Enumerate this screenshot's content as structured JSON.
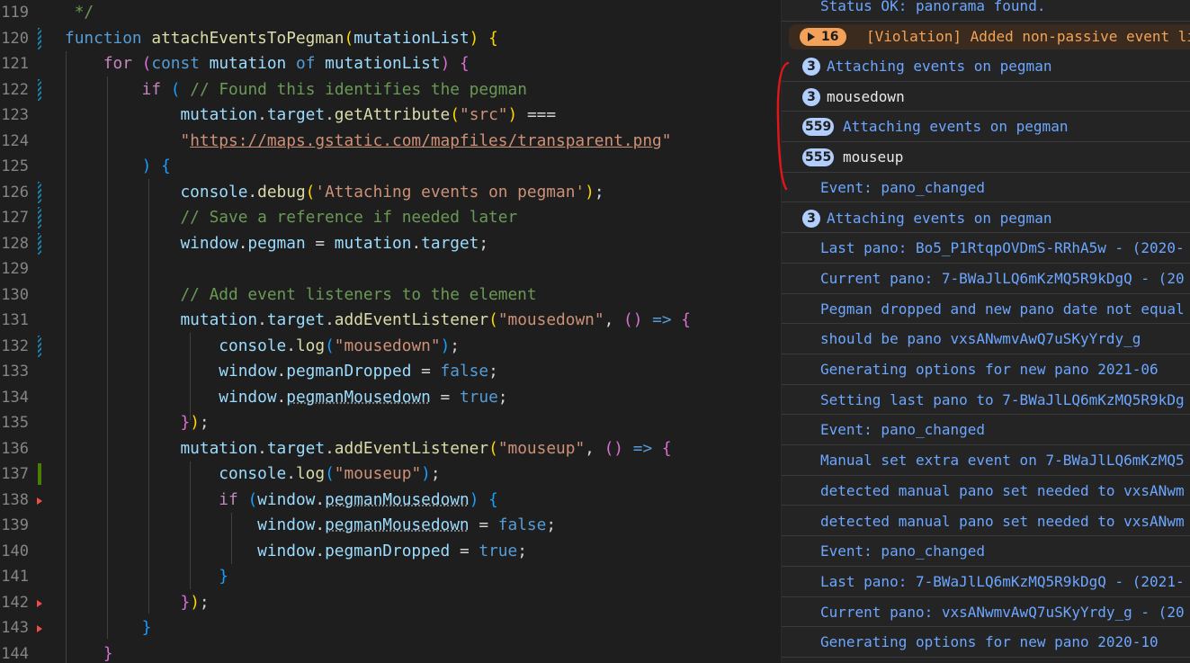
{
  "editor": {
    "lines": [
      {
        "n": "119",
        "gutter": "",
        "tokens": [
          [
            "t-cmt",
            " */"
          ]
        ]
      },
      {
        "n": "120",
        "gutter": "mod",
        "tokens": [
          [
            "t-kw",
            "function "
          ],
          [
            "t-fn",
            "attachEventsToPegman"
          ],
          [
            "t-p1",
            "("
          ],
          [
            "t-var",
            "mutationList"
          ],
          [
            "t-p1",
            ")"
          ],
          [
            "t-op",
            " "
          ],
          [
            "t-p1",
            "{"
          ]
        ]
      },
      {
        "n": "121",
        "gutter": "",
        "tokens": [
          [
            "t-op",
            "    "
          ],
          [
            "t-ctl",
            "for"
          ],
          [
            "t-op",
            " "
          ],
          [
            "t-p2",
            "("
          ],
          [
            "t-kw",
            "const "
          ],
          [
            "t-var",
            "mutation"
          ],
          [
            "t-op",
            " "
          ],
          [
            "t-kw",
            "of "
          ],
          [
            "t-var",
            "mutationList"
          ],
          [
            "t-p2",
            ")"
          ],
          [
            "t-op",
            " "
          ],
          [
            "t-p2",
            "{"
          ]
        ]
      },
      {
        "n": "122",
        "gutter": "mod",
        "tokens": [
          [
            "t-op",
            "        "
          ],
          [
            "t-ctl",
            "if"
          ],
          [
            "t-op",
            " "
          ],
          [
            "t-p3",
            "("
          ],
          [
            "t-op",
            " "
          ],
          [
            "t-cmt",
            "// Found this identifies the pegman"
          ]
        ]
      },
      {
        "n": "123",
        "gutter": "",
        "tokens": [
          [
            "t-op",
            "            "
          ],
          [
            "t-var",
            "mutation"
          ],
          [
            "t-op",
            "."
          ],
          [
            "t-var",
            "target"
          ],
          [
            "t-op",
            "."
          ],
          [
            "t-fn",
            "getAttribute"
          ],
          [
            "t-p1",
            "("
          ],
          [
            "t-str",
            "\"src\""
          ],
          [
            "t-p1",
            ")"
          ],
          [
            "t-op",
            " ==="
          ]
        ]
      },
      {
        "n": "124",
        "gutter": "",
        "tokens": [
          [
            "t-op",
            "            "
          ],
          [
            "t-str",
            "\""
          ],
          [
            "t-link",
            "https://maps.gstatic.com/mapfiles/transparent.png"
          ],
          [
            "t-str",
            "\""
          ]
        ]
      },
      {
        "n": "125",
        "gutter": "",
        "tokens": [
          [
            "t-op",
            "        "
          ],
          [
            "t-p3",
            ")"
          ],
          [
            "t-op",
            " "
          ],
          [
            "t-p3",
            "{"
          ]
        ]
      },
      {
        "n": "126",
        "gutter": "mod",
        "tokens": [
          [
            "t-op",
            "            "
          ],
          [
            "t-var",
            "console"
          ],
          [
            "t-op",
            "."
          ],
          [
            "t-fn",
            "debug"
          ],
          [
            "t-p1",
            "("
          ],
          [
            "t-str",
            "'Attaching events on pegman'"
          ],
          [
            "t-p1",
            ")"
          ],
          [
            "t-op",
            ";"
          ]
        ]
      },
      {
        "n": "127",
        "gutter": "mod",
        "tokens": [
          [
            "t-op",
            "            "
          ],
          [
            "t-cmt",
            "// Save a reference if needed later"
          ]
        ]
      },
      {
        "n": "128",
        "gutter": "mod",
        "tokens": [
          [
            "t-op",
            "            "
          ],
          [
            "t-var",
            "window"
          ],
          [
            "t-op",
            "."
          ],
          [
            "t-var",
            "pegman"
          ],
          [
            "t-op",
            " = "
          ],
          [
            "t-var",
            "mutation"
          ],
          [
            "t-op",
            "."
          ],
          [
            "t-var",
            "target"
          ],
          [
            "t-op",
            ";"
          ]
        ]
      },
      {
        "n": "129",
        "gutter": "",
        "tokens": []
      },
      {
        "n": "130",
        "gutter": "",
        "tokens": [
          [
            "t-op",
            "            "
          ],
          [
            "t-cmt",
            "// Add event listeners to the element"
          ]
        ]
      },
      {
        "n": "131",
        "gutter": "",
        "tokens": [
          [
            "t-op",
            "            "
          ],
          [
            "t-var",
            "mutation"
          ],
          [
            "t-op",
            "."
          ],
          [
            "t-var",
            "target"
          ],
          [
            "t-op",
            "."
          ],
          [
            "t-fn",
            "addEventListener"
          ],
          [
            "t-p1",
            "("
          ],
          [
            "t-str",
            "\"mousedown\""
          ],
          [
            "t-op",
            ", "
          ],
          [
            "t-p2",
            "()"
          ],
          [
            "t-op",
            " "
          ],
          [
            "t-kw",
            "=>"
          ],
          [
            "t-op",
            " "
          ],
          [
            "t-p2",
            "{"
          ]
        ]
      },
      {
        "n": "132",
        "gutter": "mod",
        "tokens": [
          [
            "t-op",
            "                "
          ],
          [
            "t-var",
            "console"
          ],
          [
            "t-op",
            "."
          ],
          [
            "t-fn",
            "log"
          ],
          [
            "t-p3",
            "("
          ],
          [
            "t-str",
            "\"mousedown\""
          ],
          [
            "t-p3",
            ")"
          ],
          [
            "t-op",
            ";"
          ]
        ]
      },
      {
        "n": "133",
        "gutter": "",
        "tokens": [
          [
            "t-op",
            "                "
          ],
          [
            "t-var",
            "window"
          ],
          [
            "t-op",
            "."
          ],
          [
            "t-var",
            "pegmanDropped"
          ],
          [
            "t-op",
            " = "
          ],
          [
            "t-kw",
            "false"
          ],
          [
            "t-op",
            ";"
          ]
        ]
      },
      {
        "n": "134",
        "gutter": "",
        "tokens": [
          [
            "t-op",
            "                "
          ],
          [
            "t-var",
            "window"
          ],
          [
            "t-op",
            "."
          ],
          [
            "t-var t-dot",
            "pegmanMousedown"
          ],
          [
            "t-op",
            " = "
          ],
          [
            "t-kw",
            "true"
          ],
          [
            "t-op",
            ";"
          ]
        ]
      },
      {
        "n": "135",
        "gutter": "",
        "tokens": [
          [
            "t-op",
            "            "
          ],
          [
            "t-p2",
            "}"
          ],
          [
            "t-p1",
            ")"
          ],
          [
            "t-op",
            ";"
          ]
        ]
      },
      {
        "n": "136",
        "gutter": "",
        "tokens": [
          [
            "t-op",
            "            "
          ],
          [
            "t-var",
            "mutation"
          ],
          [
            "t-op",
            "."
          ],
          [
            "t-var",
            "target"
          ],
          [
            "t-op",
            "."
          ],
          [
            "t-fn",
            "addEventListener"
          ],
          [
            "t-p1",
            "("
          ],
          [
            "t-str",
            "\"mouseup\""
          ],
          [
            "t-op",
            ", "
          ],
          [
            "t-p2",
            "()"
          ],
          [
            "t-op",
            " "
          ],
          [
            "t-kw",
            "=>"
          ],
          [
            "t-op",
            " "
          ],
          [
            "t-p2",
            "{"
          ]
        ]
      },
      {
        "n": "137",
        "gutter": "add",
        "tokens": [
          [
            "t-op",
            "                "
          ],
          [
            "t-var",
            "console"
          ],
          [
            "t-op",
            "."
          ],
          [
            "t-fn",
            "log"
          ],
          [
            "t-p3",
            "("
          ],
          [
            "t-str",
            "\"mouseup\""
          ],
          [
            "t-p3",
            ")"
          ],
          [
            "t-op",
            ";"
          ]
        ]
      },
      {
        "n": "138",
        "gutter": "del",
        "tokens": [
          [
            "t-op",
            "                "
          ],
          [
            "t-ctl",
            "if"
          ],
          [
            "t-op",
            " "
          ],
          [
            "t-p3",
            "("
          ],
          [
            "t-var",
            "window"
          ],
          [
            "t-op",
            "."
          ],
          [
            "t-var t-dot",
            "pegmanMousedown"
          ],
          [
            "t-p3",
            ")"
          ],
          [
            "t-op",
            " "
          ],
          [
            "t-p3",
            "{"
          ]
        ]
      },
      {
        "n": "139",
        "gutter": "",
        "tokens": [
          [
            "t-op",
            "                    "
          ],
          [
            "t-var",
            "window"
          ],
          [
            "t-op",
            "."
          ],
          [
            "t-var t-dot",
            "pegmanMousedown"
          ],
          [
            "t-op",
            " = "
          ],
          [
            "t-kw",
            "false"
          ],
          [
            "t-op",
            ";"
          ]
        ]
      },
      {
        "n": "140",
        "gutter": "",
        "tokens": [
          [
            "t-op",
            "                    "
          ],
          [
            "t-var",
            "window"
          ],
          [
            "t-op",
            "."
          ],
          [
            "t-var",
            "pegmanDropped"
          ],
          [
            "t-op",
            " = "
          ],
          [
            "t-kw",
            "true"
          ],
          [
            "t-op",
            ";"
          ]
        ]
      },
      {
        "n": "141",
        "gutter": "",
        "tokens": [
          [
            "t-op",
            "                "
          ],
          [
            "t-p3",
            "}"
          ]
        ]
      },
      {
        "n": "142",
        "gutter": "del",
        "tokens": [
          [
            "t-op",
            "            "
          ],
          [
            "t-p2",
            "}"
          ],
          [
            "t-p1",
            ")"
          ],
          [
            "t-op",
            ";"
          ]
        ]
      },
      {
        "n": "143",
        "gutter": "del",
        "tokens": [
          [
            "t-op",
            "        "
          ],
          [
            "t-p3",
            "}"
          ]
        ]
      },
      {
        "n": "144",
        "gutter": "",
        "tokens": [
          [
            "t-op",
            "    "
          ],
          [
            "t-p2",
            "}"
          ]
        ]
      }
    ]
  },
  "console": {
    "top_message": "Status OK: panorama found.",
    "warning": {
      "count": "16",
      "text": "[Violation] Added non-passive event li"
    },
    "messages": [
      {
        "badge": "3",
        "text": "Attaching events on pegman",
        "color": "blue"
      },
      {
        "badge": "3",
        "text": "mousedown",
        "color": "white"
      },
      {
        "badge": "559",
        "text": "Attaching events on pegman",
        "color": "blue"
      },
      {
        "badge": "555",
        "text": "mouseup",
        "color": "white"
      },
      {
        "badge": "",
        "text": "Event: pano_changed",
        "color": "blue"
      },
      {
        "badge": "3",
        "text": "Attaching events on pegman",
        "color": "blue"
      },
      {
        "badge": "",
        "text": "Last pano: Bo5_P1RtqpOVDmS-RRhA5w - (2020-",
        "color": "blue"
      },
      {
        "badge": "",
        "text": "Current pano: 7-BWaJlLQ6mKzMQ5R9kDgQ - (20",
        "color": "blue"
      },
      {
        "badge": "",
        "text": "Pegman dropped and new pano date not equal",
        "color": "blue"
      },
      {
        "badge": "",
        "text": "should be pano vxsANwmvAwQ7uSKyYrdy_g",
        "color": "blue"
      },
      {
        "badge": "",
        "text": "Generating options for new pano 2021-06",
        "color": "blue"
      },
      {
        "badge": "",
        "text": "Setting last pano to 7-BWaJlLQ6mKzMQ5R9kDg",
        "color": "blue"
      },
      {
        "badge": "",
        "text": "Event: pano_changed",
        "color": "blue"
      },
      {
        "badge": "",
        "text": "Manual set extra event on 7-BWaJlLQ6mKzMQ5",
        "color": "blue"
      },
      {
        "badge": "",
        "text": "detected manual pano set needed to vxsANwm",
        "color": "blue"
      },
      {
        "badge": "",
        "text": "detected manual pano set needed to vxsANwm",
        "color": "blue"
      },
      {
        "badge": "",
        "text": "Event: pano_changed",
        "color": "blue"
      },
      {
        "badge": "",
        "text": "Last pano: 7-BWaJlLQ6mKzMQ5R9kDgQ - (2021-",
        "color": "blue"
      },
      {
        "badge": "",
        "text": "Current pano: vxsANwmvAwQ7uSKyYrdy_g - (20",
        "color": "blue"
      },
      {
        "badge": "",
        "text": "Generating options for new pano 2020-10",
        "color": "blue"
      }
    ]
  },
  "colors": {
    "annotation": "#e0161b",
    "badge": "#b2cefc",
    "warning": "#f4a15a"
  }
}
